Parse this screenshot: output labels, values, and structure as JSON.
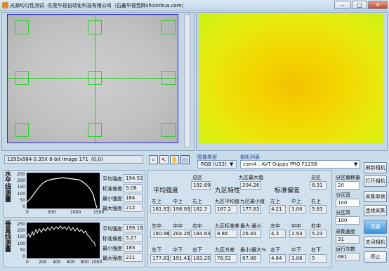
{
  "window": {
    "title": "光源均匀性测试 -东莞华视自动化科技有限公司（石鑫华视觉网shixinhua.com）",
    "minimize": "–",
    "maximize": "□",
    "close": "✕"
  },
  "image_info": {
    "text": "1292x964 0.35X 8-bit image 171",
    "coords": "(0,0)"
  },
  "tools": [
    "magnifier-icon",
    "pointer-icon",
    "hand-icon",
    "fit-icon"
  ],
  "image_type": {
    "label": "图像类型",
    "value": "RGB (U32)"
  },
  "camera": {
    "label": "相机列表",
    "value": "cam4 : AVT Guppy PRO F125B"
  },
  "right_buttons": {
    "refresh": "刷新相机",
    "open": "打开相机",
    "single": "采集单帧",
    "continuous": "连续采集",
    "measure": "测量",
    "close_cam": "关闭相机",
    "stop": "停止"
  },
  "params": {
    "offset_label": "分区偏移量",
    "offset_value": "20",
    "width_label": "分区宽",
    "width_value": "100",
    "height_label": "分区高",
    "height_value": "100",
    "speed_label": "采集速度",
    "speed_value": "31",
    "count_label": "运行次数",
    "count_value": "681"
  },
  "h_profile": {
    "title": "水平线测量",
    "y_ticks": [
      "250",
      "200",
      "150",
      "100",
      "50",
      "0"
    ],
    "x_ticks": [
      "0",
      "500",
      "1000",
      "1500"
    ],
    "stats": [
      {
        "label": "平均强度",
        "value": "194.52"
      },
      {
        "label": "标准偏差",
        "value": "9.08"
      },
      {
        "label": "最小强度",
        "value": "164"
      },
      {
        "label": "最大强度",
        "value": "212"
      }
    ]
  },
  "v_profile": {
    "title": "垂直线测量",
    "y_ticks": [
      "250",
      "200",
      "150",
      "100",
      "50",
      "0"
    ],
    "x_ticks": [
      "0",
      "200",
      "400",
      "600",
      "800",
      "1000"
    ],
    "stats": [
      {
        "label": "平均强度",
        "value": "199.16"
      },
      {
        "label": "标准偏差",
        "value": "5.27"
      },
      {
        "label": "最小强度",
        "value": "183"
      },
      {
        "label": "最大强度",
        "value": "211"
      }
    ]
  },
  "avg_intensity": {
    "title": "平均强度",
    "total_label": "总区",
    "total_value": "192.69",
    "labels": [
      "左上",
      "中上",
      "右上",
      "左中",
      "中中",
      "右中",
      "左下",
      "中下",
      "右下"
    ],
    "values": [
      "181.83",
      "198.09",
      "182.3",
      "180.98",
      "204.26",
      "184.83",
      "177.83",
      "191.41",
      "183.25"
    ]
  },
  "nine_zone": {
    "title": "九区特性",
    "max_label": "九区最大值",
    "max_value": "204.26",
    "avg_label": "九区平均值",
    "avg_value": "187.2",
    "min_label": "九区最小值",
    "min_value": "177.83",
    "std_label": "九区标准差",
    "std_value": "8.86",
    "range_label": "最大-最小",
    "range_value": "26.44",
    "var_label": "九区方差",
    "var_value": "78.52",
    "ratio_label": "最小/最大%",
    "ratio_value": "87.06"
  },
  "std_dev": {
    "title": "标准偏差",
    "total_label": "总区",
    "total_value": "8.31",
    "labels": [
      "左上",
      "中上",
      "右上",
      "左中",
      "中中",
      "右中",
      "左下",
      "中下",
      "右下"
    ],
    "values": [
      "4.21",
      "3.06",
      "5.83",
      "4.3",
      "2.93",
      "5.23",
      "4.64",
      "3.06",
      "5"
    ]
  }
}
